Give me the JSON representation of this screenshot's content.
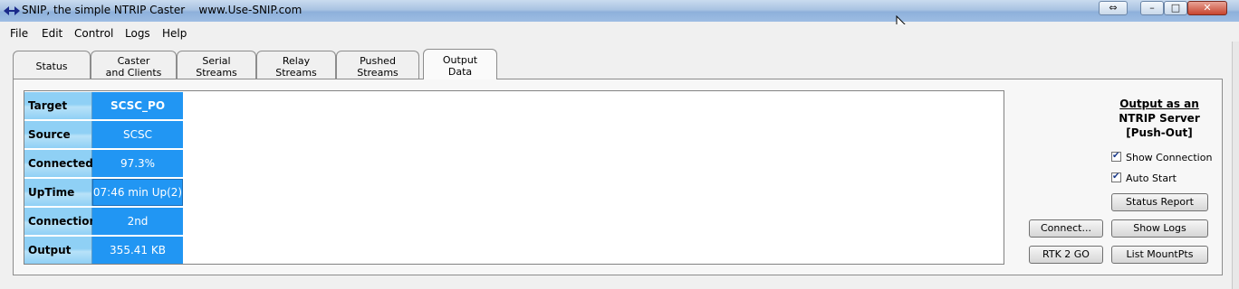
{
  "window": {
    "title": "SNIP, the simple NTRIP Caster    www.Use-SNIP.com",
    "controls": {
      "restore": "⇔",
      "minimize": "–",
      "maximize": "□",
      "close": "✕"
    }
  },
  "menu": [
    "File",
    "Edit",
    "Control",
    "Logs",
    "Help"
  ],
  "tabs": [
    {
      "line1": "Status",
      "line2": ""
    },
    {
      "line1": "Caster",
      "line2": "and Clients"
    },
    {
      "line1": "Serial",
      "line2": "Streams"
    },
    {
      "line1": "Relay",
      "line2": "Streams"
    },
    {
      "line1": "Pushed",
      "line2": "Streams"
    },
    {
      "line1": "Output",
      "line2": "Data"
    }
  ],
  "active_tab": "Output Data",
  "output_rows": [
    {
      "label": "Target",
      "value": "SCSC_PO"
    },
    {
      "label": "Source",
      "value": "SCSC"
    },
    {
      "label": "Connected",
      "value": "97.3%"
    },
    {
      "label": "UpTime",
      "value": "07:46 min Up(2)"
    },
    {
      "label": "Connections",
      "value": "2nd"
    },
    {
      "label": "Output",
      "value": "355.41 KB"
    }
  ],
  "side_panel": {
    "heading_line1": "Output as an",
    "heading_line2": "NTRIP Server",
    "heading_line3": "[Push-Out]",
    "show_connection_label": "Show  Connection",
    "show_connection_checked": true,
    "auto_start_label": "Auto Start",
    "auto_start_checked": true,
    "check_mark": "✔",
    "buttons": {
      "status_report": "Status Report",
      "connect": "Connect...",
      "show_logs": "Show Logs",
      "rtk2go": "RTK 2 GO",
      "list_mountpts": "List MountPts"
    }
  },
  "colors": {
    "value_bg": "#2196f3",
    "label_bg": "#8fd0f5",
    "titlebar": "#a9c3e2"
  }
}
